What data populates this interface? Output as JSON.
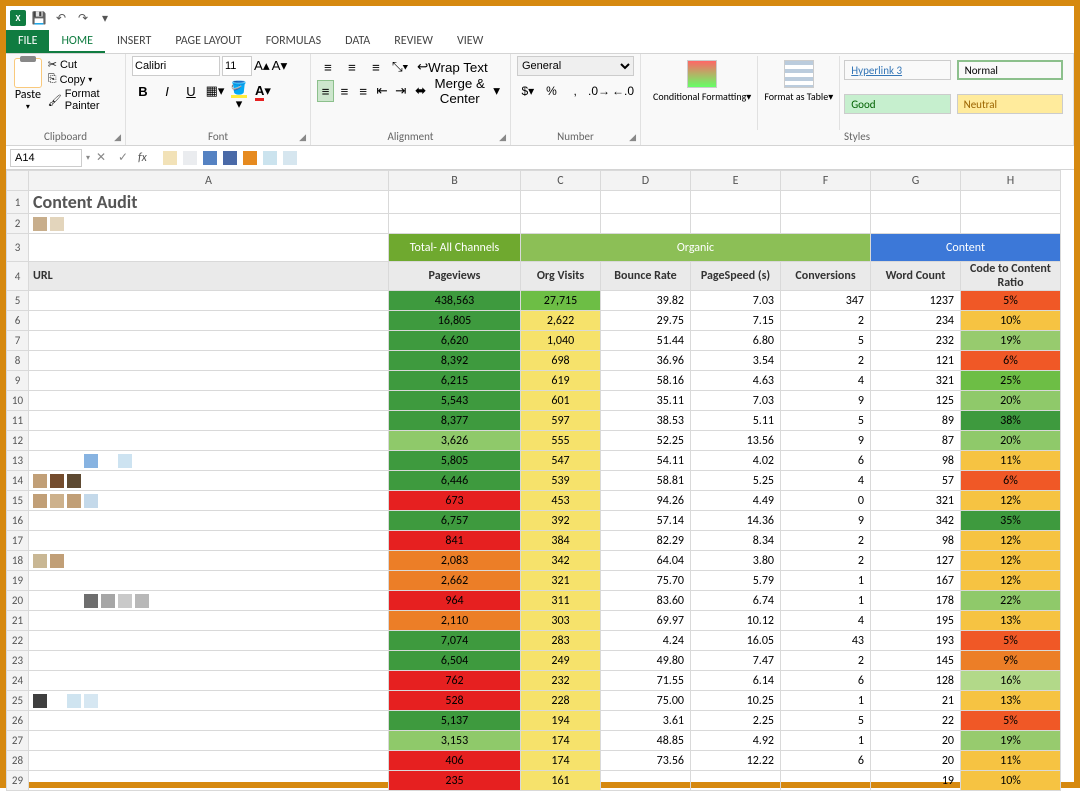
{
  "qat": {
    "app_initials": "X"
  },
  "tabs": {
    "file": "FILE",
    "home": "HOME",
    "insert": "INSERT",
    "page_layout": "PAGE LAYOUT",
    "formulas": "FORMULAS",
    "data": "DATA",
    "review": "REVIEW",
    "view": "VIEW"
  },
  "ribbon": {
    "clipboard": {
      "label": "Clipboard",
      "paste": "Paste",
      "cut": "Cut",
      "copy": "Copy",
      "format_painter": "Format Painter"
    },
    "font": {
      "label": "Font",
      "family": "Calibri",
      "size": "11",
      "bold": "B",
      "italic": "I",
      "underline": "U"
    },
    "alignment": {
      "label": "Alignment",
      "wrap": "Wrap Text",
      "merge": "Merge & Center"
    },
    "number": {
      "label": "Number",
      "format": "General"
    },
    "styles": {
      "label": "Styles",
      "conditional": "Conditional Formatting",
      "table": "Format as Table",
      "hyperlink": "Hyperlink 3",
      "normal": "Normal",
      "good": "Good",
      "neutral": "Neutral"
    }
  },
  "formula_bar": {
    "cell_ref": "A14",
    "swatch_colors": [
      "#F2E2B8",
      "#EAECEF",
      "#5582C2",
      "#4A6AA8",
      "#E68A1F",
      "#CBE3EE",
      "#D6E6EF"
    ]
  },
  "column_letters": [
    "A",
    "B",
    "C",
    "D",
    "E",
    "F",
    "G",
    "H"
  ],
  "row_numbers": [
    "1",
    "2",
    "3",
    "4",
    "5",
    "6",
    "7",
    "8",
    "9",
    "10",
    "11",
    "12",
    "13",
    "14",
    "15",
    "16",
    "17",
    "18",
    "19",
    "20",
    "21",
    "22",
    "23",
    "24",
    "25",
    "26",
    "27",
    "28",
    "29"
  ],
  "workbook": {
    "title": "Content Audit",
    "section_total": "Total- All Channels",
    "section_organic": "Organic",
    "section_content": "Content",
    "headers": {
      "url": "URL",
      "pageviews": "Pageviews",
      "org_visits": "Org Visits",
      "bounce": "Bounce Rate",
      "pagespeed": "PageSpeed (s)",
      "conversions": "Conversions",
      "wordcount": "Word Count",
      "ratio": "Code to Content Ratio"
    },
    "rows": [
      {
        "pv": "438,563",
        "pvC": "#3E9A3E",
        "ov": "27,715",
        "ovC": "#6DBE45",
        "br": "39.82",
        "ps": "7.03",
        "cv": "347",
        "wc": "1237",
        "r": "5%",
        "rC": "#F05826"
      },
      {
        "pv": "16,805",
        "pvC": "#3E9A3E",
        "ov": "2,622",
        "ovC": "#F6E26B",
        "br": "29.75",
        "ps": "7.15",
        "cv": "2",
        "wc": "234",
        "r": "10%",
        "rC": "#F6C342"
      },
      {
        "pv": "6,620",
        "pvC": "#3E9A3E",
        "ov": "1,040",
        "ovC": "#F6E26B",
        "br": "51.44",
        "ps": "6.80",
        "cv": "5",
        "wc": "232",
        "r": "19%",
        "rC": "#97CB6E"
      },
      {
        "pv": "8,392",
        "pvC": "#3E9A3E",
        "ov": "698",
        "ovC": "#F6E26B",
        "br": "36.96",
        "ps": "3.54",
        "cv": "2",
        "wc": "121",
        "r": "6%",
        "rC": "#F05826"
      },
      {
        "pv": "6,215",
        "pvC": "#3E9A3E",
        "ov": "619",
        "ovC": "#F6E26B",
        "br": "58.16",
        "ps": "4.63",
        "cv": "4",
        "wc": "321",
        "r": "25%",
        "rC": "#6DBE45"
      },
      {
        "pv": "5,543",
        "pvC": "#3E9A3E",
        "ov": "601",
        "ovC": "#F6E26B",
        "br": "35.11",
        "ps": "7.03",
        "cv": "9",
        "wc": "125",
        "r": "20%",
        "rC": "#8FC96A"
      },
      {
        "pv": "8,377",
        "pvC": "#3E9A3E",
        "ov": "597",
        "ovC": "#F6E26B",
        "br": "38.53",
        "ps": "5.11",
        "cv": "5",
        "wc": "89",
        "r": "38%",
        "rC": "#3E9A3E"
      },
      {
        "pv": "3,626",
        "pvC": "#8FC96A",
        "ov": "555",
        "ovC": "#F6E26B",
        "br": "52.25",
        "ps": "13.56",
        "cv": "9",
        "wc": "87",
        "r": "20%",
        "rC": "#8FC96A"
      },
      {
        "pv": "5,805",
        "pvC": "#3E9A3E",
        "ov": "547",
        "ovC": "#F6E26B",
        "br": "54.11",
        "ps": "4.02",
        "cv": "6",
        "wc": "98",
        "r": "11%",
        "rC": "#F6C342"
      },
      {
        "pv": "6,446",
        "pvC": "#3E9A3E",
        "ov": "539",
        "ovC": "#F6E26B",
        "br": "58.81",
        "ps": "5.25",
        "cv": "4",
        "wc": "57",
        "r": "6%",
        "rC": "#F05826"
      },
      {
        "pv": "673",
        "pvC": "#E62020",
        "ov": "453",
        "ovC": "#F6E26B",
        "br": "94.26",
        "ps": "4.49",
        "cv": "0",
        "wc": "321",
        "r": "12%",
        "rC": "#F6C342"
      },
      {
        "pv": "6,757",
        "pvC": "#3E9A3E",
        "ov": "392",
        "ovC": "#F6E26B",
        "br": "57.14",
        "ps": "14.36",
        "cv": "9",
        "wc": "342",
        "r": "35%",
        "rC": "#3E9A3E"
      },
      {
        "pv": "841",
        "pvC": "#E62020",
        "ov": "384",
        "ovC": "#F6E26B",
        "br": "82.29",
        "ps": "8.34",
        "cv": "2",
        "wc": "98",
        "r": "12%",
        "rC": "#F6C342"
      },
      {
        "pv": "2,083",
        "pvC": "#EC7E27",
        "ov": "342",
        "ovC": "#F6E26B",
        "br": "64.04",
        "ps": "3.80",
        "cv": "2",
        "wc": "127",
        "r": "12%",
        "rC": "#F6C342"
      },
      {
        "pv": "2,662",
        "pvC": "#EC7E27",
        "ov": "321",
        "ovC": "#F6E26B",
        "br": "75.70",
        "ps": "5.79",
        "cv": "1",
        "wc": "167",
        "r": "12%",
        "rC": "#F6C342"
      },
      {
        "pv": "964",
        "pvC": "#E62020",
        "ov": "311",
        "ovC": "#F6E26B",
        "br": "83.60",
        "ps": "6.74",
        "cv": "1",
        "wc": "178",
        "r": "22%",
        "rC": "#8FC96A"
      },
      {
        "pv": "2,110",
        "pvC": "#EC7E27",
        "ov": "303",
        "ovC": "#F6E26B",
        "br": "69.97",
        "ps": "10.12",
        "cv": "4",
        "wc": "195",
        "r": "13%",
        "rC": "#F6C342"
      },
      {
        "pv": "7,074",
        "pvC": "#3E9A3E",
        "ov": "283",
        "ovC": "#F6E26B",
        "br": "4.24",
        "ps": "16.05",
        "cv": "43",
        "wc": "193",
        "r": "5%",
        "rC": "#F05826"
      },
      {
        "pv": "6,504",
        "pvC": "#3E9A3E",
        "ov": "249",
        "ovC": "#F6E26B",
        "br": "49.80",
        "ps": "7.47",
        "cv": "2",
        "wc": "145",
        "r": "9%",
        "rC": "#EC7E27"
      },
      {
        "pv": "762",
        "pvC": "#E62020",
        "ov": "232",
        "ovC": "#F6E26B",
        "br": "71.55",
        "ps": "6.14",
        "cv": "6",
        "wc": "128",
        "r": "16%",
        "rC": "#B2D989"
      },
      {
        "pv": "528",
        "pvC": "#E62020",
        "ov": "228",
        "ovC": "#F6E26B",
        "br": "75.00",
        "ps": "10.25",
        "cv": "1",
        "wc": "21",
        "r": "13%",
        "rC": "#F6C342"
      },
      {
        "pv": "5,137",
        "pvC": "#3E9A3E",
        "ov": "194",
        "ovC": "#F6E26B",
        "br": "3.61",
        "ps": "2.25",
        "cv": "5",
        "wc": "22",
        "r": "5%",
        "rC": "#F05826"
      },
      {
        "pv": "3,153",
        "pvC": "#8FC96A",
        "ov": "174",
        "ovC": "#F6E26B",
        "br": "48.85",
        "ps": "4.92",
        "cv": "1",
        "wc": "20",
        "r": "19%",
        "rC": "#97CB6E"
      },
      {
        "pv": "406",
        "pvC": "#E62020",
        "ov": "174",
        "ovC": "#F6E26B",
        "br": "73.56",
        "ps": "12.22",
        "cv": "6",
        "wc": "20",
        "r": "11%",
        "rC": "#F6C342"
      },
      {
        "pv": "235",
        "pvC": "#E62020",
        "ov": "161",
        "ovC": "#F6E26B",
        "br": "",
        "ps": "",
        "cv": "",
        "wc": "19",
        "r": "10%",
        "rC": "#F6C342"
      }
    ],
    "url_pixels": [
      [
        "#C8AE8C",
        "#E3D5BC"
      ],
      [],
      [],
      [],
      [],
      [],
      [],
      [],
      [],
      [
        "#ffffff",
        "#ffffff",
        "#ffffff",
        "#87B3E1",
        "#ffffff",
        "#CDE3F1"
      ],
      [
        "#C19F77",
        "#744C2D",
        "#5E4A32"
      ],
      [
        "#C19F77",
        "#CDB18C",
        "#C19F77",
        "#C4D9EA"
      ],
      [],
      [],
      [
        "#C9B794",
        "#C19F77"
      ],
      [],
      [
        "#ffffff",
        "#ffffff",
        "#ffffff",
        "#6E6E6E",
        "#A6A6A6",
        "#C9C9C9",
        "#B8B8B8"
      ],
      [],
      [],
      [],
      [],
      [
        "#3F3F3F",
        "#ffffff",
        "#CFE4F0",
        "#D6E7F2"
      ],
      [],
      [],
      []
    ]
  }
}
